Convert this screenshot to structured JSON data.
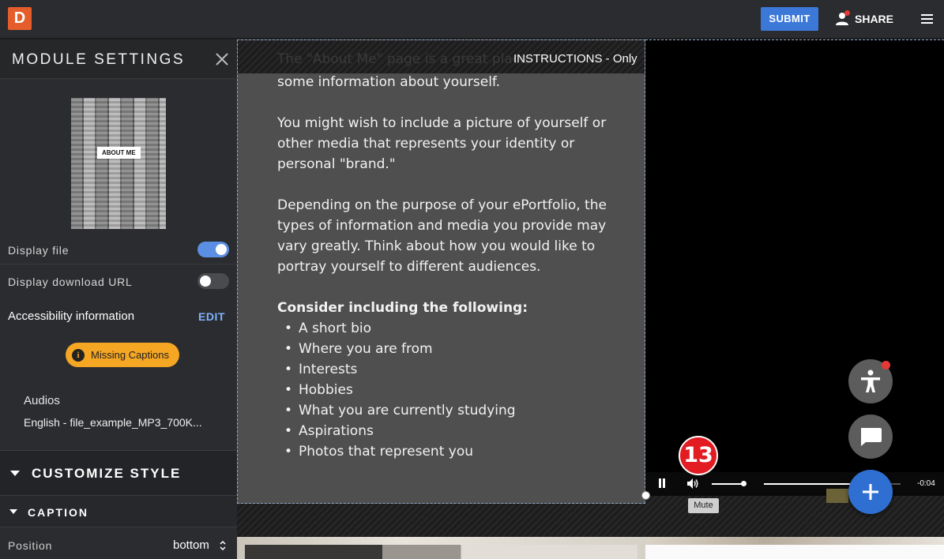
{
  "app": {
    "logo_letter": "D",
    "submit_label": "SUBMIT",
    "share_label": "SHARE"
  },
  "panel": {
    "title": "MODULE SETTINGS",
    "thumbnail_caption": "ABOUT ME",
    "display_file_label": "Display file",
    "display_file_on": true,
    "display_download_label": "Display download URL",
    "display_download_on": false,
    "accessibility_label": "Accessibility information",
    "edit_label": "EDIT",
    "missing_captions_label": "Missing Captions",
    "audios_label": "Audios",
    "audio_file": "English - file_example_MP3_700K...",
    "customize_style_label": "CUSTOMIZE STYLE",
    "caption_label": "CAPTION",
    "position_label": "Position",
    "position_value": "bottom"
  },
  "text_module": {
    "faded_line": "The \"About Me\" page is a great place",
    "instructions_label": "INSTRUCTIONS - Only",
    "para1": "some information about yourself.",
    "para2": "You might wish to include a picture of yourself or other media that represents your identity or personal \"brand.\"",
    "para3": "Depending on the purpose of your ePortfolio, the types of information and media you provide may vary greatly. Think about how you would like to portray yourself to different audiences.",
    "list_heading": "Consider including the following:",
    "list_items": [
      "A short bio",
      "Where you are from",
      "Interests",
      "Hobbies",
      "What you are currently studying",
      "Aspirations",
      "Photos that represent you"
    ]
  },
  "player": {
    "time_remaining": "-0:04",
    "mute_tooltip": "Mute",
    "volume_level": 0.95,
    "seek_progress": 0.64
  },
  "step_badge": "13",
  "colors": {
    "accent_blue": "#3c78d8",
    "warning": "#f5a623",
    "badge_red": "#e31b23",
    "logo_orange": "#e55d2b"
  }
}
